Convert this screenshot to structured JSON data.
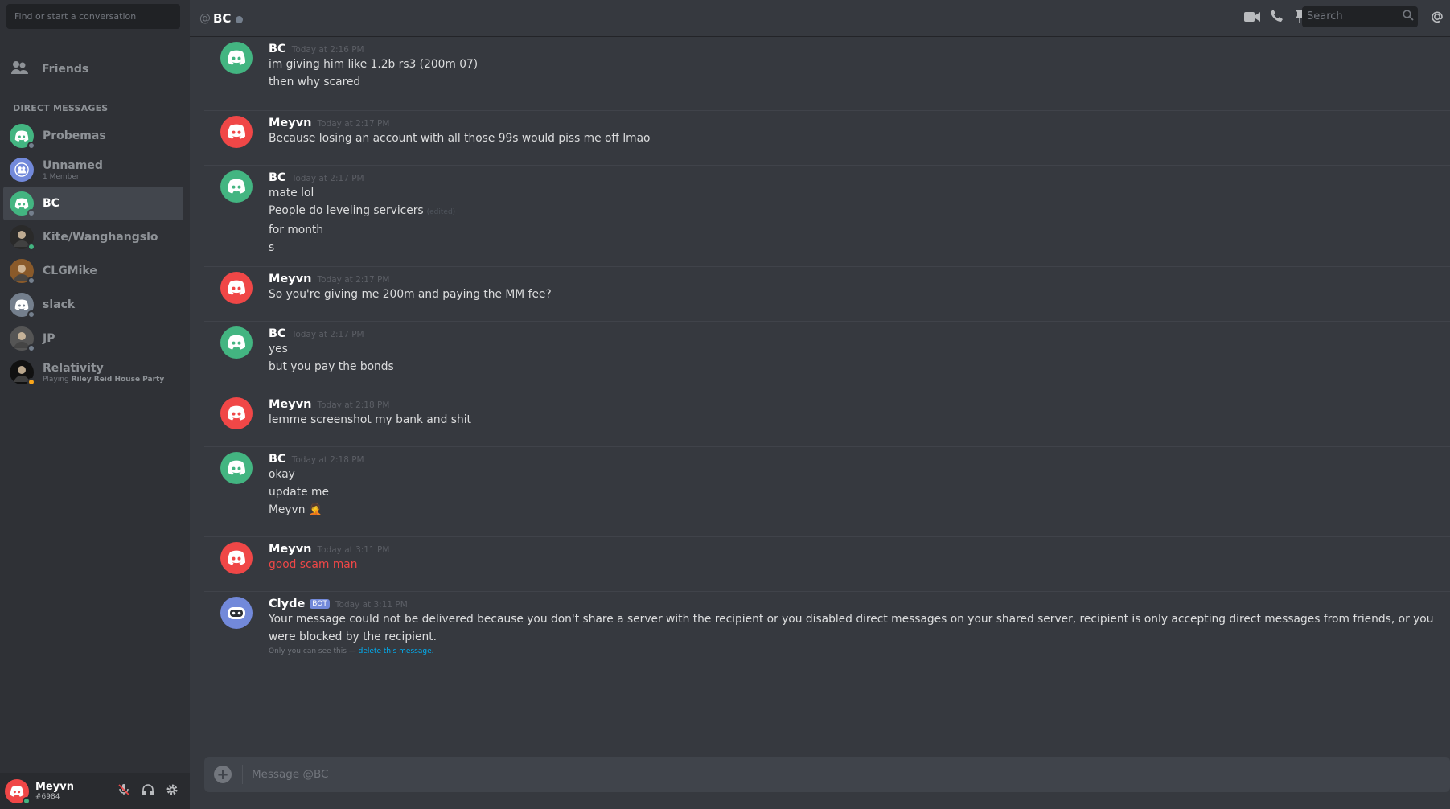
{
  "sidebar": {
    "search_placeholder": "Find or start a conversation",
    "friends_label": "Friends",
    "dm_header": "DIRECT MESSAGES",
    "dms": [
      {
        "name": "Probemas",
        "sub": "",
        "sub_bold": "",
        "avatar_color": "#43b581",
        "status": "#747f8d",
        "avatar": "discord"
      },
      {
        "name": "Unnamed",
        "sub": "1 Member",
        "sub_bold": "",
        "avatar_color": "#7289da",
        "status": "",
        "avatar": "group"
      },
      {
        "name": "BC",
        "sub": "",
        "sub_bold": "",
        "avatar_color": "#43b581",
        "status": "#747f8d",
        "avatar": "discord",
        "active": true
      },
      {
        "name": "Kite/Wanghangslo",
        "sub": "",
        "sub_bold": "",
        "avatar_color": "#2a2a2a",
        "status": "#43b581",
        "avatar": "photo"
      },
      {
        "name": "CLGMike",
        "sub": "",
        "sub_bold": "",
        "avatar_color": "#8a5a2a",
        "status": "#747f8d",
        "avatar": "photo"
      },
      {
        "name": "slack",
        "sub": "",
        "sub_bold": "",
        "avatar_color": "#747f8d",
        "status": "#747f8d",
        "avatar": "discord"
      },
      {
        "name": "JP",
        "sub": "",
        "sub_bold": "",
        "avatar_color": "#555555",
        "status": "#747f8d",
        "avatar": "photo"
      },
      {
        "name": "Relativity",
        "sub": "Playing ",
        "sub_bold": "Riley Reid House Party",
        "avatar_color": "#111111",
        "status": "#faa61a",
        "avatar": "photo"
      }
    ],
    "user": {
      "name": "Meyvn",
      "tag": "#6984"
    }
  },
  "topbar": {
    "at": "@",
    "channel": "BC",
    "search_placeholder": "Search"
  },
  "messages": [
    {
      "author": "BC",
      "time": "Today at 2:16 PM",
      "color": "#43b581",
      "lines": [
        "im giving him like 1.2b rs3 (200m 07)",
        "then why scared"
      ]
    },
    {
      "author": "Meyvn",
      "time": "Today at 2:17 PM",
      "color": "#f04747",
      "lines": [
        "Because losing an account with all those 99s would piss me off lmao"
      ]
    },
    {
      "author": "BC",
      "time": "Today at 2:17 PM",
      "color": "#43b581",
      "lines": [
        "mate lol",
        "People do leveling servicers",
        "for month",
        "s"
      ],
      "edited_line": 1,
      "edited_label": "(edited)"
    },
    {
      "author": "Meyvn",
      "time": "Today at 2:17 PM",
      "color": "#f04747",
      "lines": [
        "So you're giving me 200m and paying the MM fee?"
      ]
    },
    {
      "author": "BC",
      "time": "Today at 2:17 PM",
      "color": "#43b581",
      "lines": [
        "yes",
        "but you pay the bonds"
      ]
    },
    {
      "author": "Meyvn",
      "time": "Today at 2:18 PM",
      "color": "#f04747",
      "lines": [
        "lemme screenshot my bank and shit"
      ]
    },
    {
      "author": "BC",
      "time": "Today at 2:18 PM",
      "color": "#43b581",
      "lines": [
        "okay",
        "update me",
        "Meyvn 🤦"
      ]
    },
    {
      "author": "Meyvn",
      "time": "Today at 3:11 PM",
      "color": "#f04747",
      "lines": [
        "good scam man"
      ],
      "red": true
    },
    {
      "author": "Clyde",
      "time": "Today at 3:11 PM",
      "color": "#7289da",
      "bot": "BOT",
      "lines": [
        "Your message could not be delivered because you don't share a server with the recipient or you disabled direct messages on your shared server, recipient is only accepting direct messages from friends, or you were blocked by the recipient."
      ],
      "note": "Only you can see this — ",
      "note_link": "delete this message."
    }
  ],
  "composer": {
    "placeholder": "Message @BC"
  }
}
